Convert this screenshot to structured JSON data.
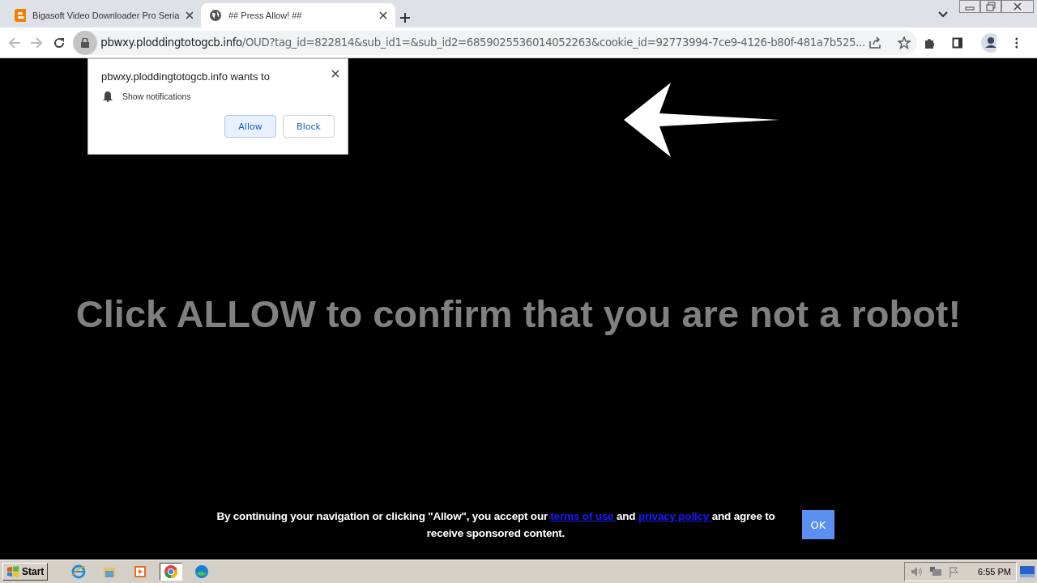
{
  "tabs": [
    {
      "title": "Bigasoft Video Downloader Pro Seria",
      "kind": "blogger",
      "selected": false
    },
    {
      "title": "## Press Allow! ##",
      "kind": "globe",
      "selected": true
    }
  ],
  "address_bar": {
    "domain": "pbwxy.ploddingtotogcb.info",
    "path": "/OUD?tag_id=822814&sub_id1=&sub_id2=6859025536014052263&cookie_id=92773994-7ce9-4126-b80f-481a7b525..."
  },
  "permission_popup": {
    "title": "pbwxy.ploddingtotogcb.info wants to",
    "permission": "Show notifications",
    "buttons": [
      {
        "label": "Allow",
        "kind": "primary"
      },
      {
        "label": "Block",
        "kind": "secondary"
      }
    ]
  },
  "headline": "Click ALLOW to confirm that you are not a robot!",
  "consent": {
    "before": "By continuing your navigation or clicking \"Allow\", you accept our ",
    "link1": "terms of use ",
    "middle": "and ",
    "link2": "privacy policy ",
    "after": "and agree to receive sponsored content.",
    "button": "OK"
  },
  "taskbar": {
    "start": "Start",
    "apps": [
      {
        "kind": "ie",
        "selected": false
      },
      {
        "kind": "folder",
        "selected": false
      },
      {
        "kind": "media",
        "selected": false
      },
      {
        "kind": "chrome",
        "selected": true
      },
      {
        "kind": "edge",
        "selected": false
      }
    ],
    "time": "6:55 PM"
  }
}
